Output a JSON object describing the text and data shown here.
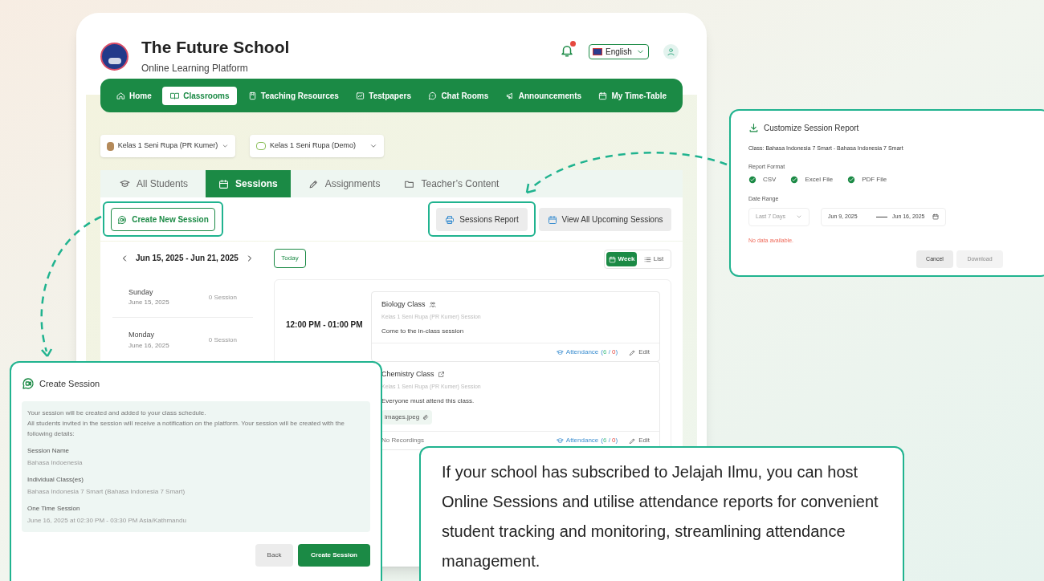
{
  "header": {
    "title": "The Future School",
    "subtitle": "Online Learning Platform",
    "language": "English"
  },
  "nav": [
    {
      "label": "Home",
      "selected": false
    },
    {
      "label": "Classrooms",
      "selected": true
    },
    {
      "label": "Teaching Resources",
      "selected": false
    },
    {
      "label": "Testpapers",
      "selected": false
    },
    {
      "label": "Chat Rooms",
      "selected": false
    },
    {
      "label": "Announcements",
      "selected": false
    },
    {
      "label": "My Time-Table",
      "selected": false
    }
  ],
  "class_selectors": [
    "Kelas 1 Seni Rupa (PR Kumer)",
    "Kelas 1 Seni Rupa (Demo)"
  ],
  "tabs": [
    {
      "label": "All Students",
      "selected": false
    },
    {
      "label": "Sessions",
      "selected": true
    },
    {
      "label": "Assignments",
      "selected": false
    },
    {
      "label": "Teacher’s Content",
      "selected": false
    }
  ],
  "toolbar": {
    "create": "Create New Session",
    "report": "Sessions Report",
    "upcoming": "View All Upcoming Sessions"
  },
  "week_nav": {
    "range": "Jun 15, 2025 - Jun 21, 2025",
    "today": "Today",
    "views": [
      {
        "label": "Week",
        "selected": true
      },
      {
        "label": "List",
        "selected": false
      }
    ]
  },
  "days": [
    {
      "day": "Sunday",
      "date": "June 15, 2025",
      "count": "0 Session"
    },
    {
      "day": "Monday",
      "date": "June 16, 2025",
      "count": "0 Session"
    }
  ],
  "time_slot": "12:00 PM - 01:00 PM",
  "sessions": [
    {
      "title": "Biology Class",
      "kind": "in_class",
      "class": "Kelas 1 Seni Rupa (PR Kumer) Session",
      "description": "Come to the in-class session",
      "attendance": "Attendance",
      "count_parts": [
        {
          "text": "(",
          "kind": "plain"
        },
        {
          "text": "6",
          "kind": "present"
        },
        {
          "text": " / ",
          "kind": "plain"
        },
        {
          "text": "0",
          "kind": "absent"
        },
        {
          "text": ")",
          "kind": "plain"
        }
      ],
      "edit": "Edit"
    },
    {
      "title": "Chemistry Class",
      "kind": "online",
      "class": "Kelas 1 Seni Rupa (PR Kumer) Session",
      "description": "Everyone must attend this class.",
      "attachment": "images.jpeg",
      "recordings": "No Recordings",
      "attendance": "Attendance",
      "count_parts": [
        {
          "text": "(",
          "kind": "plain"
        },
        {
          "text": "6",
          "kind": "present"
        },
        {
          "text": " / ",
          "kind": "plain"
        },
        {
          "text": "0",
          "kind": "absent"
        },
        {
          "text": ")",
          "kind": "plain"
        }
      ],
      "edit": "Edit"
    }
  ],
  "report_dialog": {
    "title": "Customize Session Report",
    "class_line": "Class: Bahasa Indonesia 7 Smart - Bahasa Indonesia 7 Smart",
    "format_label": "Report Format",
    "formats": [
      {
        "label": "CSV",
        "checked": true
      },
      {
        "label": "Excel File",
        "checked": true
      },
      {
        "label": "PDF File",
        "checked": true
      }
    ],
    "range_label": "Date Range",
    "range_preset": "Last 7 Days",
    "start": "Jun 9, 2025",
    "end": "Jun 16, 2025",
    "error": "No data available.",
    "cancel": "Cancel",
    "download": "Download",
    "download_disabled": true
  },
  "create_dialog": {
    "title": "Create Session",
    "intro": [
      "Your session will be created and added to your class schedule.",
      "All students invited in the session will receive a notification on the platform. Your session will be created with the following details:"
    ],
    "fields": [
      {
        "label": "Session Name",
        "value": "Bahasa Indoenesia"
      },
      {
        "label": "Individual Class(es)",
        "value": "Bahasa Indonesia 7 Smart (Bahasa Indonesia 7 Smart)"
      },
      {
        "label": "One Time Session",
        "value": "June 16, 2025 at 02:30 PM - 03:30 PM Asia/Kathmandu"
      }
    ],
    "back": "Back",
    "submit": "Create Session"
  },
  "callout": "If your school has subscribed to Jelajah Ilmu, you can host Online Sessions and utilise attendance reports for convenient student tracking and monitoring, streamlining attendance management."
}
